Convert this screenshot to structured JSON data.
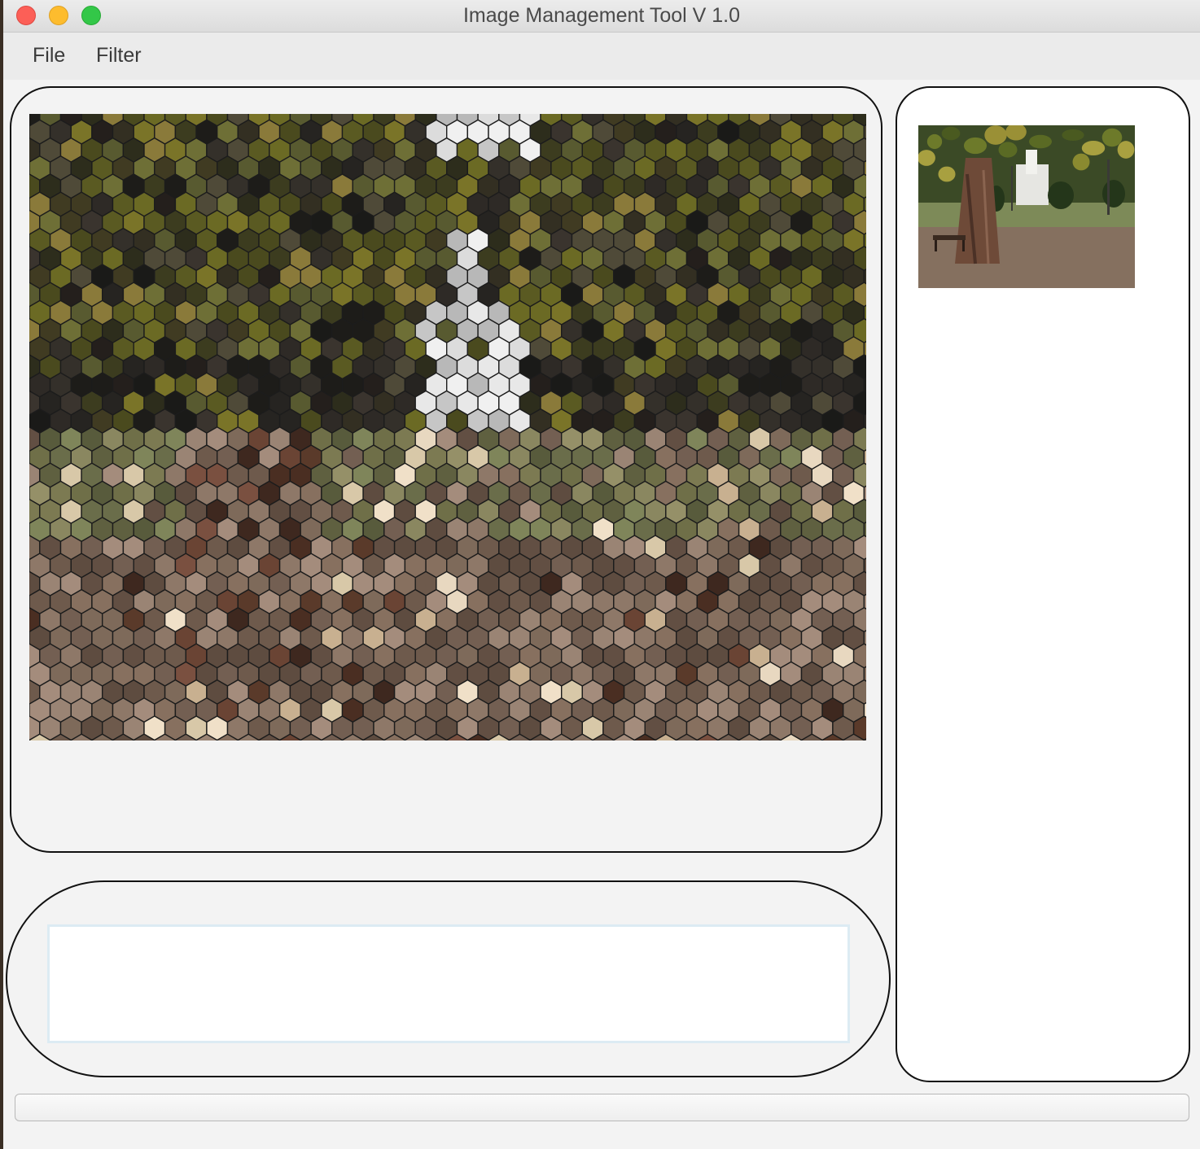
{
  "window": {
    "title": "Image Management Tool V 1.0"
  },
  "menubar": {
    "items": [
      {
        "label": "File"
      },
      {
        "label": "Filter"
      }
    ]
  },
  "log": {
    "text": ""
  },
  "status": {
    "text": ""
  },
  "palette": {
    "foliage": [
      "#4a4a1e",
      "#5a5a22",
      "#6b6a24",
      "#3c3c1f",
      "#2d2d1c",
      "#7a7428",
      "#585a30",
      "#403b22",
      "#6e6f36",
      "#8a7a3a",
      "#332f22",
      "#4f4a38"
    ],
    "dark": [
      "#262421",
      "#1d1c19",
      "#34302a",
      "#2e2a26",
      "#1a1a18",
      "#3a342e",
      "#241f1c"
    ],
    "sky": [
      "#f0f0f0",
      "#dcdcdc",
      "#c6c6c6",
      "#e8e8e8",
      "#b8b8b8"
    ],
    "grass": [
      "#6f6f48",
      "#7c7a52",
      "#8a8760",
      "#5f6040",
      "#6a6d4a",
      "#959068",
      "#585b3c",
      "#7f855a"
    ],
    "path": [
      "#7e6a5a",
      "#8e7868",
      "#6e5a4c",
      "#9a8474",
      "#5e4c40",
      "#a48c7c",
      "#735f52",
      "#87705f",
      "#624f43"
    ],
    "light": [
      "#d8c8a8",
      "#e8d8c0",
      "#c8b090",
      "#f0e0c8"
    ],
    "bark": [
      "#5a3a2a",
      "#6a4434",
      "#4a2e22",
      "#7a5040",
      "#3e281f"
    ]
  }
}
